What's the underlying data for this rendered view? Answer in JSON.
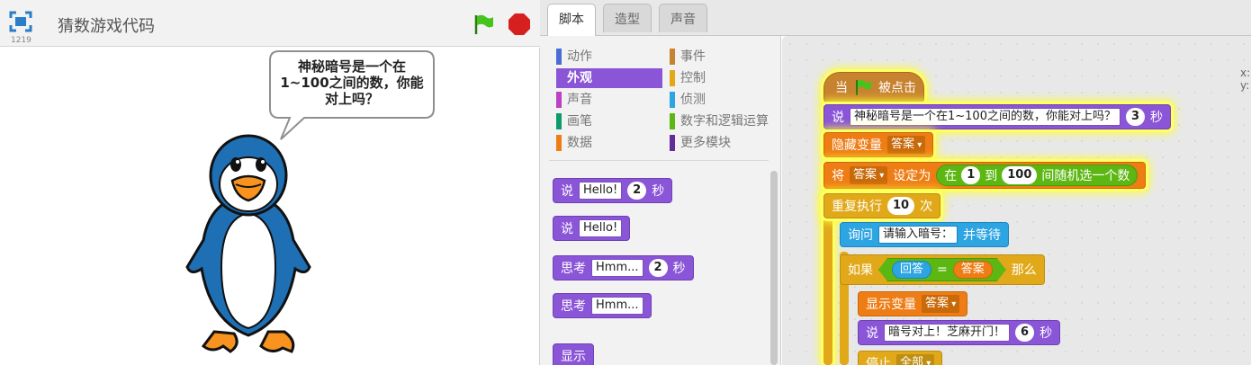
{
  "stage": {
    "title": "猜数游戏代码",
    "version": "1219",
    "speech": "神秘暗号是一个在1~100之间的数，你能对上吗？",
    "sprite": "penguin"
  },
  "tabs": [
    {
      "label": "脚本",
      "active": true
    },
    {
      "label": "造型",
      "active": false
    },
    {
      "label": "声音",
      "active": false
    }
  ],
  "categories": [
    {
      "label": "动作",
      "color": "#4a6cd4"
    },
    {
      "label": "事件",
      "color": "#c88330"
    },
    {
      "label": "外观",
      "color": "#8a55d7",
      "active": true
    },
    {
      "label": "控制",
      "color": "#e1a91a"
    },
    {
      "label": "声音",
      "color": "#bb42c3"
    },
    {
      "label": "侦测",
      "color": "#2ca5e2"
    },
    {
      "label": "画笔",
      "color": "#0e9a6c"
    },
    {
      "label": "数字和逻辑运算",
      "color": "#5cb712"
    },
    {
      "label": "数据",
      "color": "#ee7d16"
    },
    {
      "label": "更多模块",
      "color": "#632d99"
    }
  ],
  "palette_blocks": {
    "say_secs": {
      "say": "说",
      "text": "Hello!",
      "num": "2",
      "secs": "秒"
    },
    "say": {
      "say": "说",
      "text": "Hello!"
    },
    "think_secs": {
      "think": "思考",
      "text": "Hmm...",
      "num": "2",
      "secs": "秒"
    },
    "think": {
      "think": "思考",
      "text": "Hmm..."
    },
    "show": "显示"
  },
  "script": {
    "hat": {
      "when": "当",
      "clicked": "被点击"
    },
    "say1": {
      "say": "说",
      "text": "神秘暗号是一个在1~100之间的数，你能对上吗？",
      "num": "3",
      "secs": "秒"
    },
    "hide_var": {
      "label": "隐藏变量",
      "var": "答案"
    },
    "set_var": {
      "set": "将",
      "var": "答案",
      "to": "设定为",
      "pick": "在",
      "from": "1",
      "between": "到",
      "max": "100",
      "random": "间随机选一个数"
    },
    "repeat": {
      "label": "重复执行",
      "times": "10",
      "unit": "次"
    },
    "ask": {
      "ask": "询问",
      "text": "请输入暗号：",
      "wait": "并等待"
    },
    "if": {
      "if": "如果",
      "answer": "回答",
      "eq": "=",
      "var": "答案",
      "then": "那么"
    },
    "show_var": {
      "label": "显示变量",
      "var": "答案"
    },
    "say2": {
      "say": "说",
      "text": "暗号对上！芝麻开门！",
      "num": "6",
      "secs": "秒"
    },
    "stop": {
      "label": "停止",
      "opt": "全部"
    }
  },
  "sprite_info": {
    "x": "x:",
    "y": "y:"
  },
  "colors": {
    "looks": "#8a55d7",
    "events": "#c88330",
    "data": "#ee7d16",
    "control": "#e1a91a",
    "sensing": "#2ca5e2",
    "operators": "#5cb712"
  }
}
